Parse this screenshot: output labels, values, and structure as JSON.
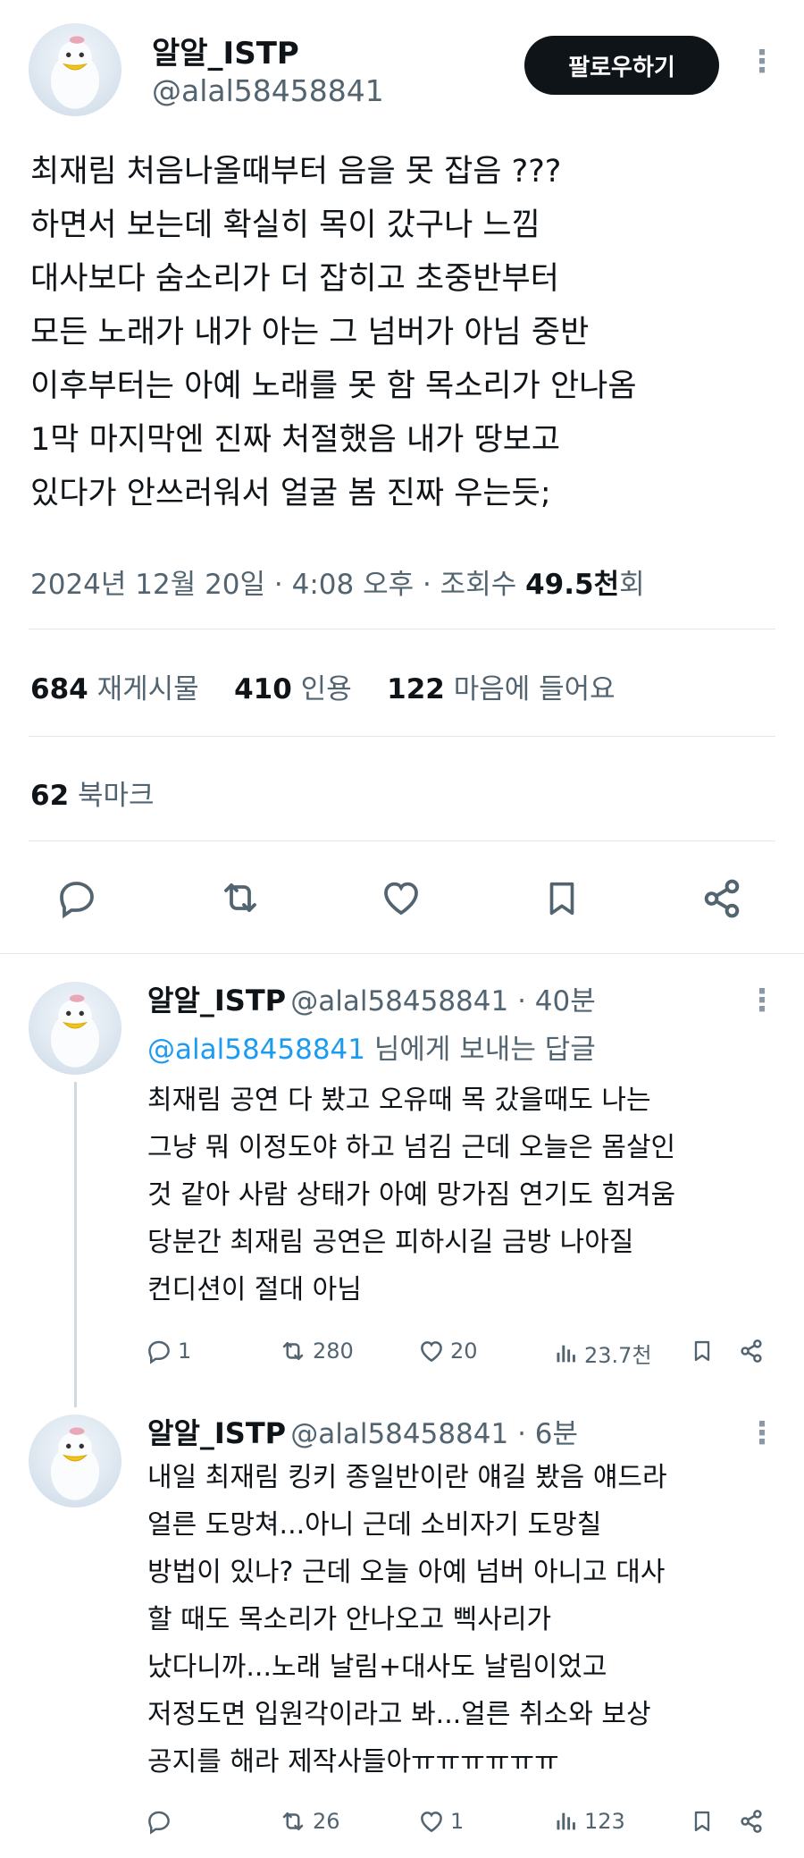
{
  "tweet": {
    "author_name": "알알_ISTP",
    "author_handle": "@alal58458841",
    "follow_label": "팔로우하기",
    "more_label": "⋮",
    "lines": [
      "최재림 처음나올때부터 음을 못 잡음 ???",
      "하면서 보는데 확실히 목이 갔구나 느낌",
      "대사보다 숨소리가 더 잡히고 초중반부터",
      "모든 노래가 내가 아는 그 넘버가 아님 중반",
      "이후부터는 아예 노래를 못 함 목소리가 안나옴",
      "1막 마지막엔 진짜 처절했음 내가 땅보고",
      "있다가 안쓰러워서 얼굴 봄 진짜 우는듯;"
    ],
    "timestamp": "2024년 12월 20일 · 4:08 오후 · 조회수 ",
    "views": "49.5천",
    "views_suffix": "회",
    "stats": {
      "retweets": "684",
      "retweets_label": "재게시물",
      "quotes": "410",
      "quotes_label": "인용",
      "likes": "122",
      "likes_label": "마음에 들어요",
      "bookmarks": "62",
      "bookmarks_label": "북마크"
    },
    "actions": [
      "reply-icon",
      "retweet-icon",
      "like-icon",
      "bookmark-icon",
      "share-icon"
    ]
  },
  "replies": [
    {
      "author_name": "알알_ISTP",
      "author_handle": "@alal58458841",
      "time": " · 40분",
      "more_label": "⋮",
      "reply_to_handle": "@alal58458841",
      "reply_to_suffix": " 님에게 보내는 답글",
      "lines": [
        "최재림 공연 다 봤고 오유때 목 갔을때도 나는",
        "그냥 뭐 이정도야 하고 넘김 근데 오늘은 몸살인",
        "것 같아 사람 상태가 아예 망가짐 연기도 힘겨움",
        "당분간 최재림 공연은 피하시길 금방 나아질",
        "컨디션이 절대 아님"
      ],
      "reply_count": "1",
      "retweet_count": "280",
      "like_count": "20",
      "view_count": "23.7천"
    },
    {
      "author_name": "알알_ISTP",
      "author_handle": "@alal58458841",
      "time": " · 6분",
      "more_label": "⋮",
      "lines": [
        "내일 최재림 킹키 종일반이란 얘길 봤음 얘드라",
        "얼른 도망쳐...아니 근데 소비자기 도망칠",
        "방법이 있나? 근데 오늘 아예 넘버 아니고 대사",
        "할 때도 목소리가 안나오고 삑사리가",
        "났다니까...노래 날림+대사도 날림이었고",
        "저정도면 입원각이라고 봐...얼른 취소와 보상",
        "공지를 해라 제작사들아ㅠㅠㅠㅠㅠㅠ"
      ],
      "reply_count": "",
      "retweet_count": "26",
      "like_count": "1",
      "view_count": "123"
    }
  ],
  "colors": {
    "text": "#0f1419",
    "secondary": "#536471",
    "link": "#1d9bf0",
    "divider": "#e3e7ea"
  }
}
